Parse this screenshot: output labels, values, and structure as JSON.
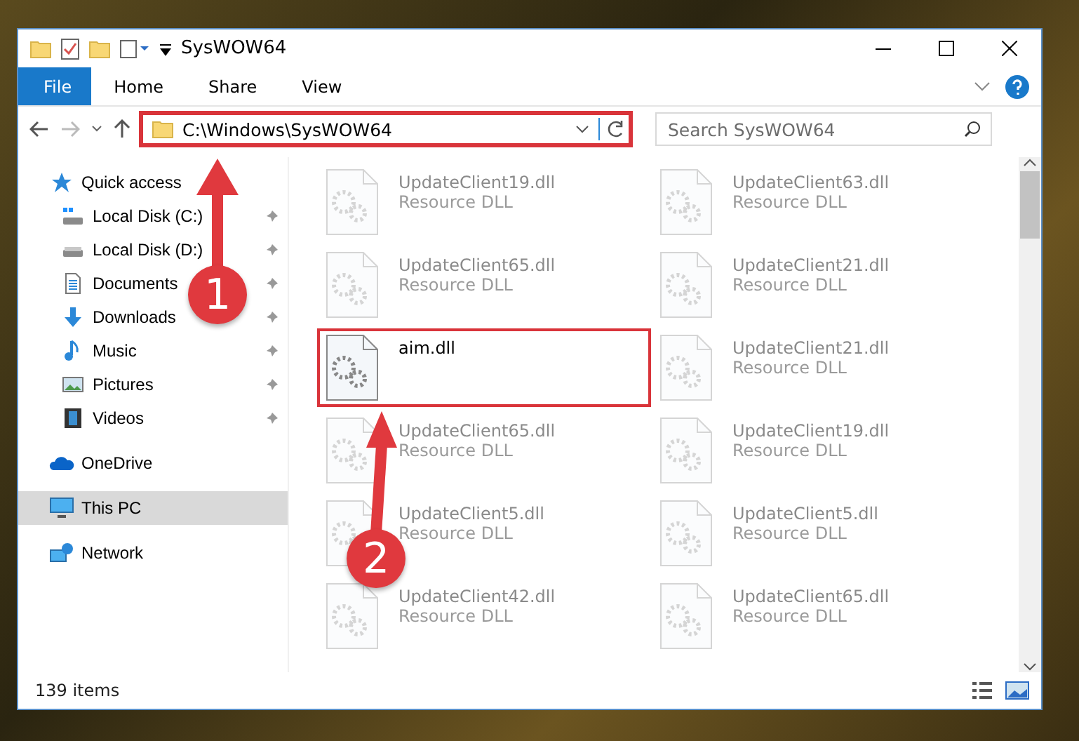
{
  "window": {
    "title": "SysWOW64"
  },
  "ribbon_tabs": [
    {
      "label": "File",
      "kind": "file",
      "selected": false
    },
    {
      "label": "Home",
      "kind": "tab",
      "selected": false
    },
    {
      "label": "Share",
      "kind": "tab",
      "selected": false
    },
    {
      "label": "View",
      "kind": "tab",
      "selected": false
    }
  ],
  "address_bar": {
    "path": "C:\\Windows\\SysWOW64",
    "highlighted": true
  },
  "search": {
    "placeholder": "Search SysWOW64"
  },
  "nav_pane": [
    {
      "label": "Quick access",
      "selected": false,
      "children": [
        {
          "label": "Local Disk (C:)",
          "pinned": true,
          "selected": false
        },
        {
          "label": "Local Disk (D:)",
          "pinned": true,
          "selected": false
        },
        {
          "label": "Documents",
          "pinned": true,
          "selected": false
        },
        {
          "label": "Downloads",
          "pinned": true,
          "selected": false
        },
        {
          "label": "Music",
          "pinned": true,
          "selected": false
        },
        {
          "label": "Pictures",
          "pinned": true,
          "selected": false
        },
        {
          "label": "Videos",
          "pinned": true,
          "selected": false
        }
      ]
    },
    {
      "label": "OneDrive",
      "selected": false
    },
    {
      "label": "This PC",
      "selected": true
    },
    {
      "label": "Network",
      "selected": false
    }
  ],
  "files": [
    {
      "name": "UpdateClient19.dll",
      "type": "Resource DLL",
      "faded": true,
      "highlighted": false
    },
    {
      "name": "UpdateClient63.dll",
      "type": "Resource DLL",
      "faded": true,
      "highlighted": false
    },
    {
      "name": "UpdateClient65.dll",
      "type": "Resource DLL",
      "faded": true,
      "highlighted": false
    },
    {
      "name": "UpdateClient21.dll",
      "type": "Resource DLL",
      "faded": true,
      "highlighted": false
    },
    {
      "name": "aim.dll",
      "faded": false,
      "highlighted": true
    },
    {
      "name": "UpdateClient21.dll",
      "type": "Resource DLL",
      "faded": true,
      "highlighted": false
    },
    {
      "name": "UpdateClient65.dll",
      "type": "Resource DLL",
      "faded": true,
      "highlighted": false
    },
    {
      "name": "UpdateClient19.dll",
      "type": "Resource DLL",
      "faded": true,
      "highlighted": false
    },
    {
      "name": "UpdateClient5.dll",
      "type": "Resource DLL",
      "faded": true,
      "highlighted": false
    },
    {
      "name": "UpdateClient5.dll",
      "type": "Resource DLL",
      "faded": true,
      "highlighted": false
    },
    {
      "name": "UpdateClient42.dll",
      "type": "Resource DLL",
      "faded": true,
      "highlighted": false
    },
    {
      "name": "UpdateClient65.dll",
      "type": "Resource DLL",
      "faded": true,
      "highlighted": false
    }
  ],
  "status_bar": {
    "item_count": "139 items"
  },
  "annotations": [
    {
      "number": "1"
    },
    {
      "number": "2"
    }
  ]
}
